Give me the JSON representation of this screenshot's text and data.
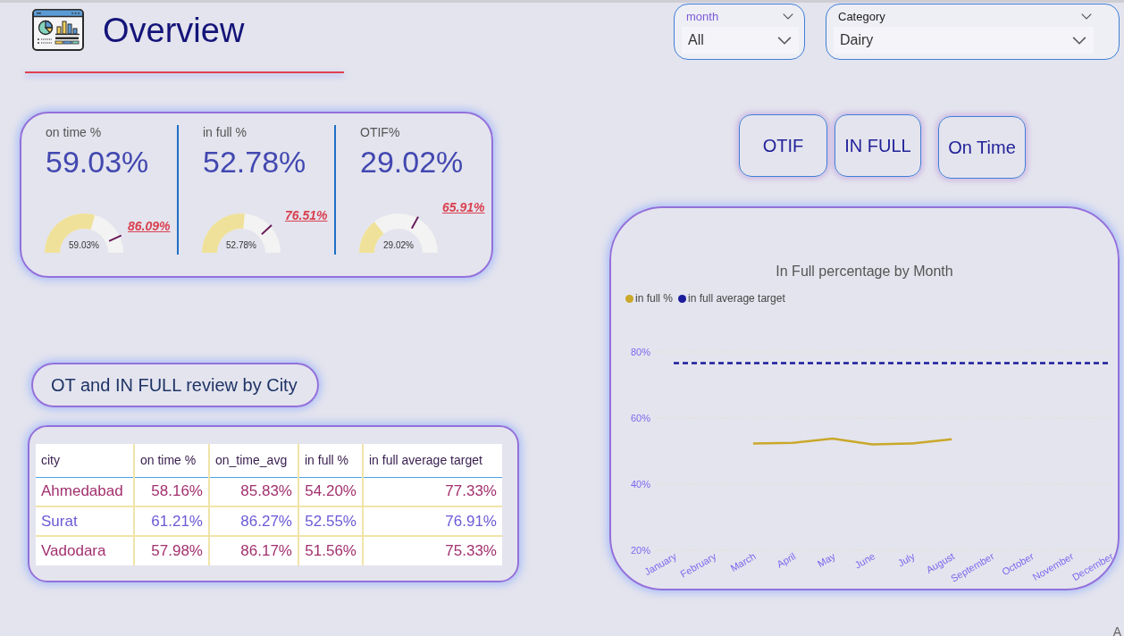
{
  "header": {
    "title": "Overview"
  },
  "slicers": [
    {
      "label": "month",
      "value": "All"
    },
    {
      "label": "Category",
      "value": "Dairy"
    }
  ],
  "kpis": [
    {
      "label": "on time %",
      "value": "59.03%",
      "gauge": {
        "level": 0.5903,
        "value_label": "59.03%",
        "target": {
          "level": 0.8609,
          "label": "86.09%"
        }
      }
    },
    {
      "label": "in full %",
      "value": "52.78%",
      "gauge": {
        "level": 0.5278,
        "value_label": "52.78%",
        "target": {
          "level": 0.7651,
          "label": "76.51%"
        }
      }
    },
    {
      "label": "OTIF%",
      "value": "29.02%",
      "gauge": {
        "level": 0.2902,
        "value_label": "29.02%",
        "target": {
          "level": 0.6591,
          "label": "65.91%"
        }
      }
    }
  ],
  "buttons": [
    "OTIF",
    "IN FULL",
    "On Time"
  ],
  "table_title": "OT and IN FULL review by City",
  "table": {
    "columns": [
      "city",
      "on time %",
      "on_time_avg",
      "in full %",
      "in full average target"
    ],
    "rows": [
      [
        "Ahmedabad",
        "58.16%",
        "85.83%",
        "54.20%",
        "77.33%"
      ],
      [
        "Surat",
        "61.21%",
        "86.27%",
        "52.55%",
        "76.91%"
      ],
      [
        "Vadodara",
        "57.98%",
        "86.17%",
        "51.56%",
        "75.33%"
      ]
    ]
  },
  "chart": {
    "chart_data": [
      {
        "type": "line",
        "title": "In Full percentage by Month",
        "categories": [
          "January",
          "February",
          "March",
          "April",
          "May",
          "June",
          "July",
          "August",
          "September",
          "October",
          "November",
          "December"
        ],
        "series": [
          {
            "name": "in full %",
            "color": "#c9a82a",
            "values": [
              null,
              null,
              52.3,
              52.5,
              53.8,
              52.0,
              52.3,
              53.6,
              null,
              null,
              null,
              null
            ]
          },
          {
            "name": "in full average target",
            "color": "#1a1a9a",
            "line_style": "dashed",
            "values": [
              76.6,
              76.6,
              76.6,
              76.6,
              76.6,
              76.6,
              76.6,
              76.6,
              76.6,
              76.6,
              76.6,
              76.6
            ]
          }
        ],
        "ylim": [
          20,
          80
        ],
        "yticks": [
          {
            "value": 20,
            "label": "20%"
          },
          {
            "value": 40,
            "label": "40%"
          },
          {
            "value": 60,
            "label": "60%"
          },
          {
            "value": 80,
            "label": "80%"
          }
        ],
        "grid": true,
        "legend": "top-left"
      }
    ]
  },
  "corner_label": "A"
}
